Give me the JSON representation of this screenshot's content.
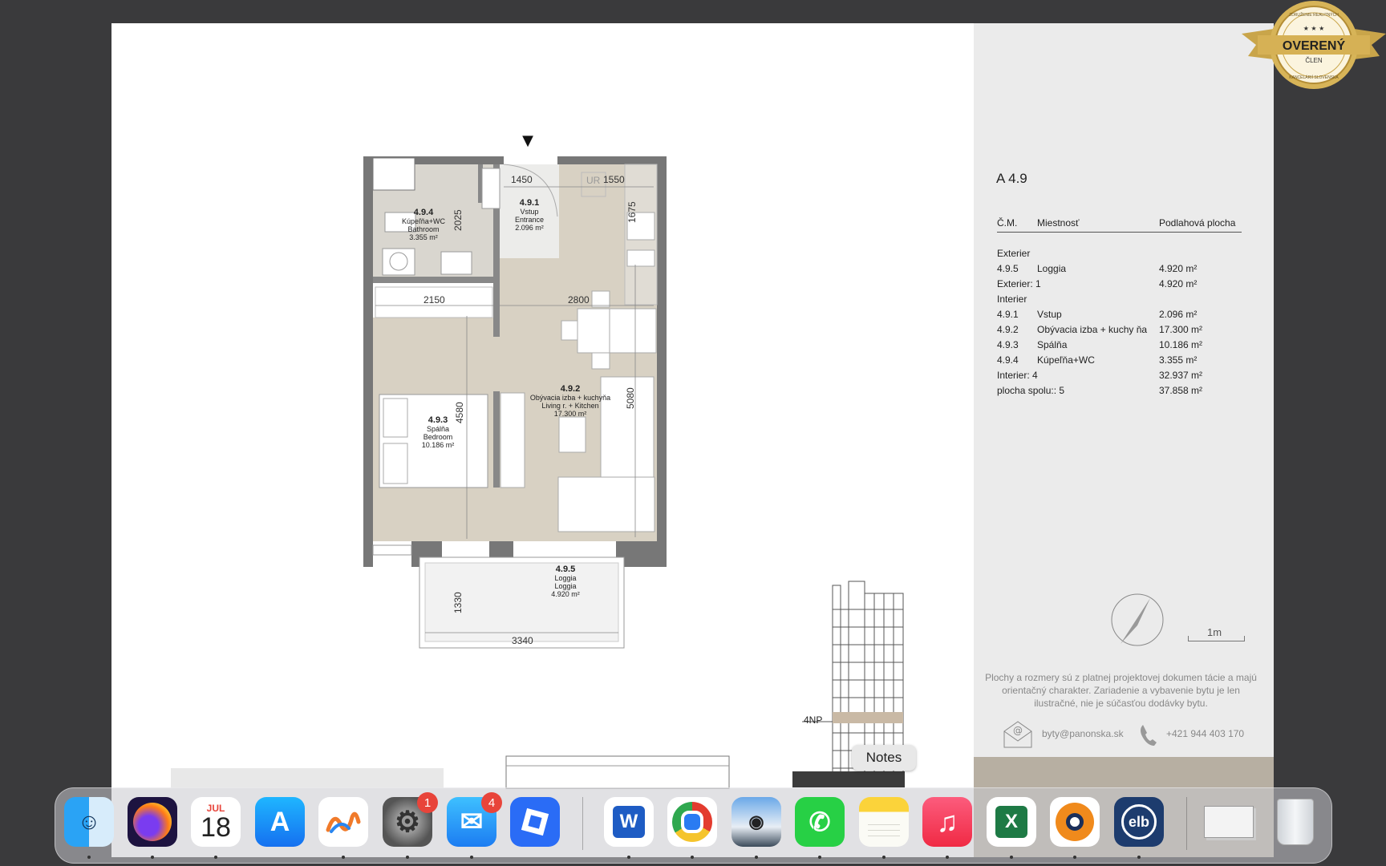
{
  "plan": {
    "entrance_marker": "▼",
    "rooms": {
      "bathroom": {
        "code": "4.9.4",
        "name_sk": "Kúpeľňa+WC",
        "name_en": "Bathroom",
        "area": "3.355 m²"
      },
      "entrance": {
        "code": "4.9.1",
        "name_sk": "Vstup",
        "name_en": "Entrance",
        "area": "2.096 m²"
      },
      "living": {
        "code": "4.9.2",
        "name_sk": "Obývacia izba + kuchyňa",
        "name_en": "Living r. + Kitchen",
        "area": "17.300 m²"
      },
      "bedroom": {
        "code": "4.9.3",
        "name_sk": "Spálňa",
        "name_en": "Bedroom",
        "area": "10.186 m²"
      },
      "loggia": {
        "code": "4.9.5",
        "name_sk": "Loggia",
        "name_en": "Loggia",
        "area": "4.920 m²"
      }
    },
    "dimensions": {
      "d1450": "1450",
      "d1550": "1550",
      "d2025": "2025",
      "d1675": "1675",
      "d2150": "2150",
      "d2800": "2800",
      "d4580": "4580",
      "d5080": "5080",
      "d1330": "1330",
      "d3340": "3340"
    },
    "ur_label": "UR",
    "floor_label": "4NP"
  },
  "sidebar": {
    "title": "A 4.9",
    "headers": {
      "code": "Č.M.",
      "room": "Miestnosť",
      "area": "Podlahová plocha"
    },
    "sections": {
      "exterior": "Exterier",
      "interior": "Interier"
    },
    "rows": [
      {
        "code": "4.9.5",
        "room": "Loggia",
        "area": "4.920 m²"
      },
      {
        "code": "Exterier: 1",
        "room": "",
        "area": "4.920 m²"
      },
      {
        "code": "4.9.1",
        "room": "Vstup",
        "area": "2.096 m²"
      },
      {
        "code": "4.9.2",
        "room": "Obývacia izba + kuchy ňa",
        "area": "17.300 m²"
      },
      {
        "code": "4.9.3",
        "room": "Spálňa",
        "area": "10.186 m²"
      },
      {
        "code": "4.9.4",
        "room": "Kúpeľňa+WC",
        "area": "3.355 m²"
      },
      {
        "code": "Interier: 4",
        "room": "",
        "area": "32.937 m²"
      },
      {
        "code": "plocha spolu:: 5",
        "room": "",
        "area": "37.858 m²"
      }
    ],
    "scale": "1m",
    "disclaimer": "Plochy a rozmery sú z platnej projektovej dokumen tácie a majú orientačný charakter. Zariadenie a vybavenie bytu je len ilustračné, nie je súčasťou dodávky bytu.",
    "email": "byty@panonska.sk",
    "phone": "+421 944 403 170"
  },
  "badge": {
    "main": "OVERENÝ",
    "sub": "ČLEN",
    "ring_top": "ZDRUŽENIE REALITNÝCH",
    "ring_bottom": "KANCELÁRIÍ SLOVENSKA"
  },
  "dock": {
    "tooltip": "Notes",
    "calendar_month": "JUL",
    "calendar_day": "18",
    "badges": {
      "settings": "1",
      "mail": "4"
    },
    "apps": [
      "finder",
      "firefox",
      "calendar",
      "app-store",
      "freeform",
      "system-settings",
      "mail",
      "roblox",
      "word",
      "chrome",
      "preview",
      "whatsapp",
      "notes",
      "music",
      "excel",
      "openvpn",
      "elb",
      "documents",
      "trash"
    ]
  }
}
